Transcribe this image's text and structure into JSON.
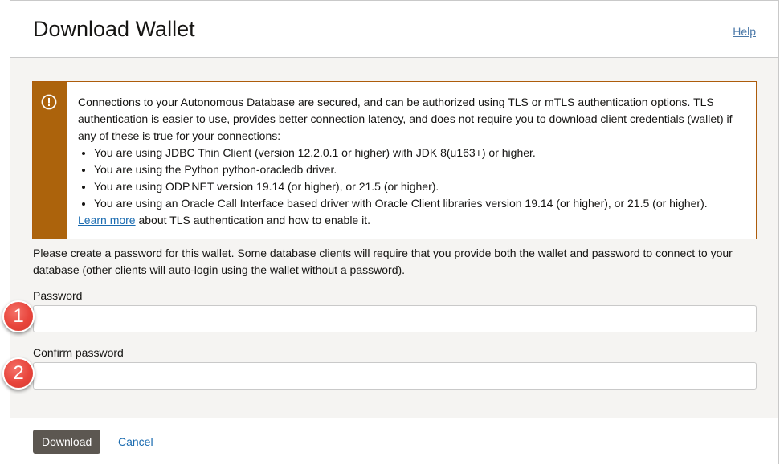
{
  "dialog": {
    "title": "Download Wallet",
    "help_label": "Help"
  },
  "notice": {
    "icon": "alert-circle-icon",
    "intro": "Connections to your Autonomous Database are secured, and can be authorized using TLS or mTLS authentication options. TLS authentication is easier to use, provides better connection latency, and does not require you to download client credentials (wallet) if any of these is true for your connections:",
    "bullets": [
      "You are using JDBC Thin Client (version 12.2.0.1 or higher) with JDK 8(u163+) or higher.",
      "You are using the Python python-oracledb driver.",
      "You are using ODP.NET version 19.14 (or higher), or 21.5 (or higher).",
      "You are using an Oracle Call Interface based driver with Oracle Client libraries version 19.14 (or higher), or 21.5 (or higher)."
    ],
    "learn_more_label": "Learn more",
    "learn_more_suffix": " about TLS authentication and how to enable it."
  },
  "form": {
    "description": "Please create a password for this wallet. Some database clients will require that you provide both the wallet and password to connect to your database (other clients will auto-login using the wallet without a password).",
    "password_label": "Password",
    "password_value": "",
    "confirm_label": "Confirm password",
    "confirm_value": ""
  },
  "footer": {
    "download_label": "Download",
    "cancel_label": "Cancel"
  },
  "markers": [
    "1",
    "2"
  ],
  "colors": {
    "warning_stripe": "#ac630c",
    "link": "#1a6bb0",
    "primary_button": "#5c5751",
    "marker": "#e8453c"
  }
}
